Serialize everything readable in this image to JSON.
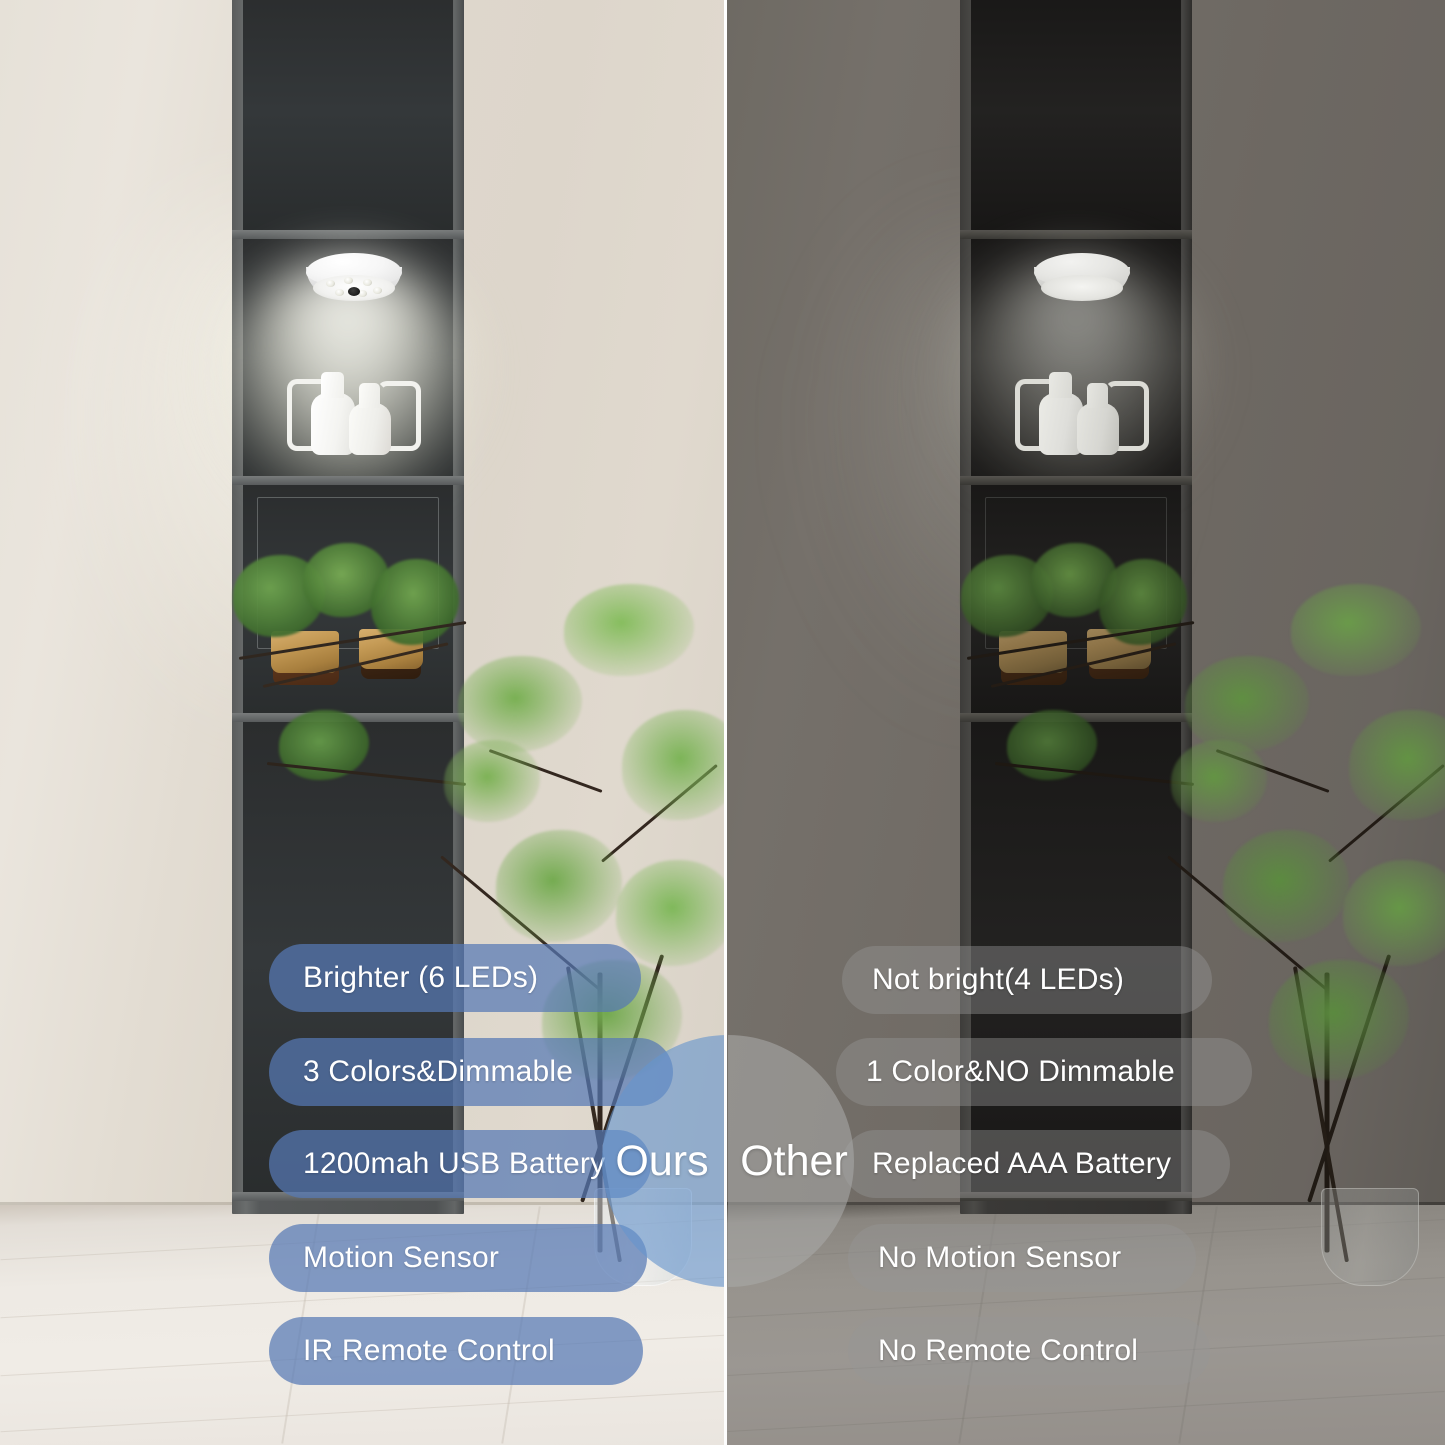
{
  "comparison": {
    "center_badge": {
      "ours_label": "Ours",
      "other_label": "Other"
    },
    "ours": {
      "accent_color": "#5679b4",
      "features": [
        "Brighter (6 LEDs)",
        "3 Colors&Dimmable",
        "1200mah USB Battery",
        "Motion Sensor",
        "IR Remote Control"
      ]
    },
    "other": {
      "accent_color": "#969696",
      "features": [
        "Not bright(4 LEDs)",
        "1 Color&NO Dimmable",
        "Replaced AAA Battery",
        "No Motion Sensor",
        "No Remote Control"
      ]
    }
  },
  "scene": {
    "left": {
      "icon_light": "puck-light-icon",
      "icon_shelf": "cabinet-icon",
      "icon_plant": "plant-icon",
      "icon_vase": "vase-icon"
    },
    "right": {
      "icon_light": "puck-light-icon",
      "icon_shelf": "cabinet-icon",
      "icon_plant": "plant-icon",
      "icon_vase": "vase-icon"
    }
  }
}
